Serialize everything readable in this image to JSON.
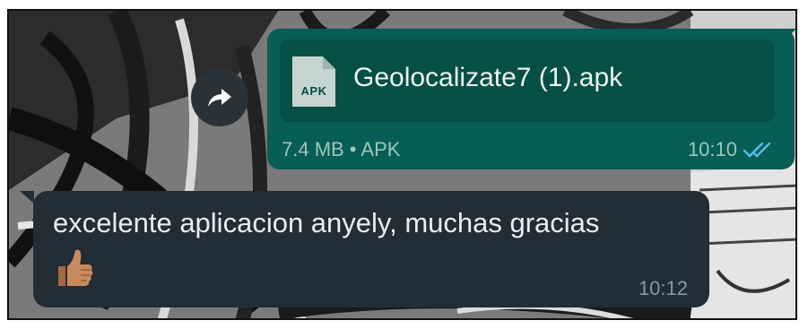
{
  "outgoing_message": {
    "file_type_label": "APK",
    "file_name": "Geolocalizate7 (1).apk",
    "file_meta": "7.4 MB • APK",
    "time": "10:10",
    "status_icon": "double-check-read-icon",
    "accent_color": "#075e54",
    "ticks_color": "#53bdeb"
  },
  "forward_icon": "forward-arrow-icon",
  "incoming_message": {
    "text": "excelente aplicacion anyely, muchas gracias",
    "emoji": "👍🏽",
    "time": "10:12",
    "bubble_color": "#232d36"
  }
}
